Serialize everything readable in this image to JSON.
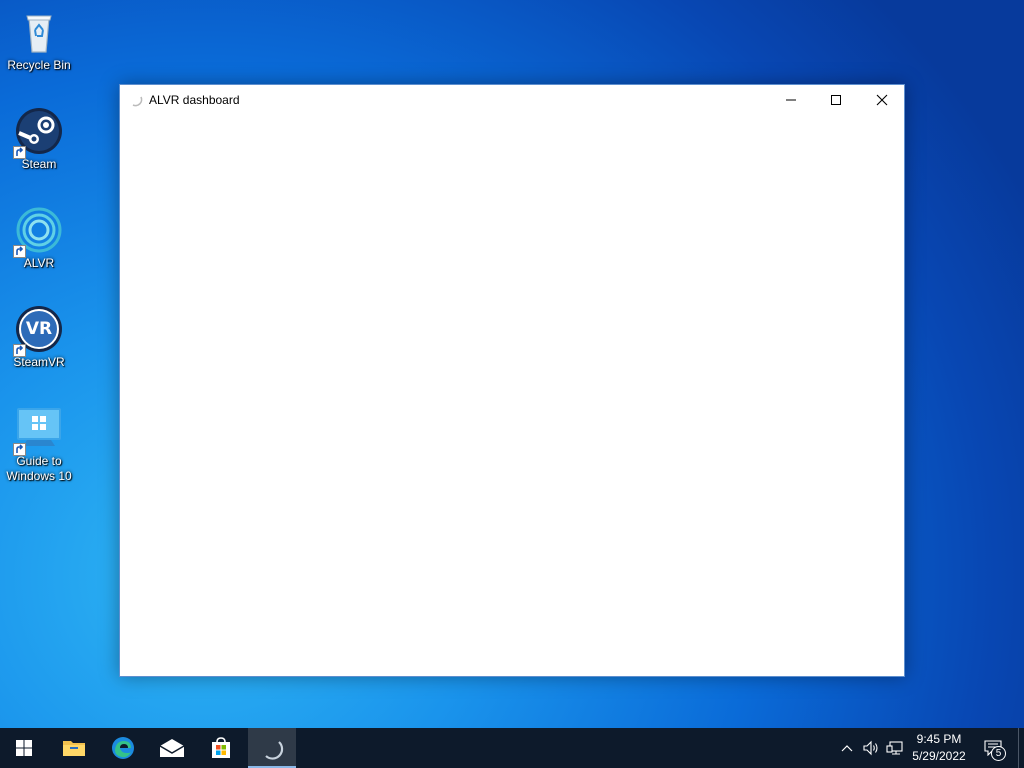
{
  "desktop": {
    "icons": [
      {
        "label": "Recycle Bin",
        "icon": "recycle-bin-icon"
      },
      {
        "label": "Steam",
        "icon": "steam-icon"
      },
      {
        "label": "ALVR",
        "icon": "alvr-icon"
      },
      {
        "label": "SteamVR",
        "icon": "steamvr-icon",
        "badge_text": "VR"
      },
      {
        "label": "Guide to Windows 10",
        "label_lines": [
          "Guide to",
          "Windows 10"
        ],
        "icon": "windows-guide-icon"
      }
    ]
  },
  "window": {
    "title": "ALVR dashboard",
    "icon": "alvr-loading-icon",
    "controls": [
      "minimize",
      "maximize",
      "close"
    ]
  },
  "taskbar": {
    "apps": [
      {
        "name": "start",
        "icon": "windows-start-icon"
      },
      {
        "name": "file-explorer",
        "icon": "folder-icon"
      },
      {
        "name": "edge",
        "icon": "edge-icon"
      },
      {
        "name": "mail",
        "icon": "mail-icon"
      },
      {
        "name": "store",
        "icon": "store-icon"
      },
      {
        "name": "alvr",
        "icon": "alvr-loading-icon",
        "active": true
      }
    ],
    "tray": {
      "time": "9:45 PM",
      "date": "5/29/2022",
      "notification_count": "5"
    }
  },
  "colors": {
    "taskbar": "#0d1a2b",
    "window_border": "#5e8fcf",
    "desktop_accent": "#0a6bd8"
  }
}
